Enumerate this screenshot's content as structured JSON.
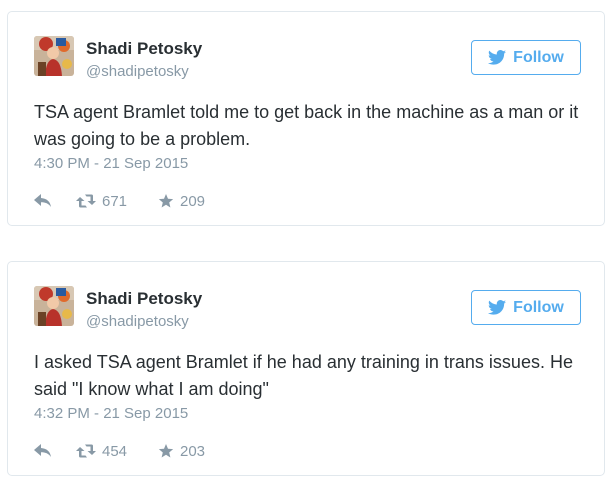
{
  "tweets": [
    {
      "author_name": "Shadi Petosky",
      "handle": "@shadipetosky",
      "follow_label": "Follow",
      "text": "TSA agent Bramlet told me to get back in the machine as a man or it was going to be a problem.",
      "timestamp": "4:30 PM - 21 Sep 2015",
      "retweets": "671",
      "favorites": "209"
    },
    {
      "author_name": "Shadi Petosky",
      "handle": "@shadipetosky",
      "follow_label": "Follow",
      "text": "I asked TSA agent Bramlet if he had any training in trans issues. He said \"I know what I am doing\"",
      "timestamp": "4:32 PM - 21 Sep 2015",
      "retweets": "454",
      "favorites": "203"
    }
  ],
  "colors": {
    "brand": "#55acee",
    "name_text": "#292f33",
    "muted": "#8899a6",
    "border": "#e1e8ed"
  },
  "icons": [
    "twitter-bird-icon",
    "reply-icon",
    "retweet-icon",
    "star-icon"
  ]
}
